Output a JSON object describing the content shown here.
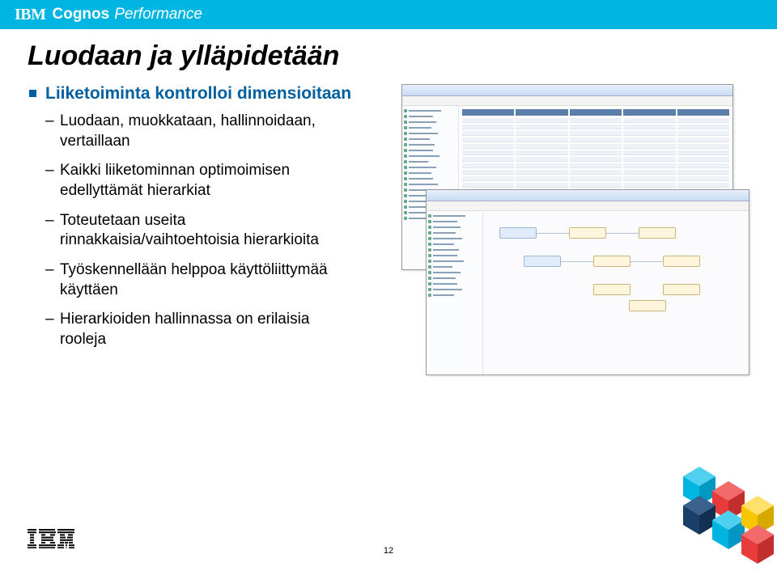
{
  "header": {
    "ibm": "IBM",
    "cognos": "Cognos",
    "performance": "Performance"
  },
  "title": "Luodaan ja ylläpidetään",
  "bullets": [
    {
      "label": "Liiketoiminta kontrolloi dimensioitaan",
      "children": [
        "Luodaan, muokkataan, hallinnoidaan, vertaillaan",
        "Kaikki liiketominnan optimoimisen edellyttämät hierarkiat",
        "Toteutetaan useita rinnakkaisia/vaihtoehtoisia hierarkioita",
        "Työskennellään helppoa käyttöliittymää käyttäen",
        "Hierarkioiden hallinnassa on erilaisia rooleja"
      ]
    }
  ],
  "page_number": "12",
  "colors": {
    "header_bg": "#00b5e2",
    "bullet_color": "#0060a0",
    "cube_cyan": "#00b5e2",
    "cube_red": "#e83c3c",
    "cube_yellow": "#f7c600",
    "cube_navy": "#1a3f6b"
  }
}
